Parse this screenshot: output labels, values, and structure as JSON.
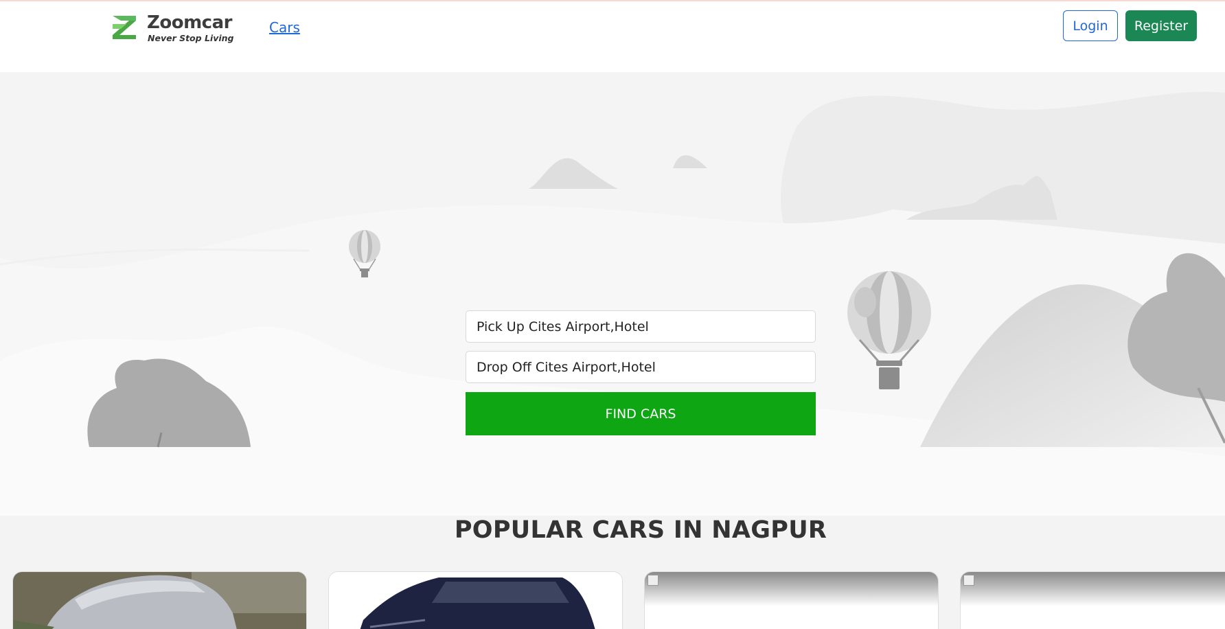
{
  "header": {
    "brand_name": "Zoomcar",
    "brand_tagline": "Never Stop Living",
    "nav_link": "Cars",
    "login_label": "Login",
    "register_label": "Register"
  },
  "search": {
    "pickup_value": "Pick Up Cites Airport,Hotel",
    "dropoff_value": "Drop Off Cites Airport,Hotel",
    "submit_label": "FIND CARS"
  },
  "popular": {
    "title": "POPULAR CARS IN NAGPUR",
    "cards": [
      {
        "image": "silver-car-photo"
      },
      {
        "image": "navy-suv-photo"
      },
      {
        "image": "broken-image"
      },
      {
        "image": "broken-image"
      }
    ]
  },
  "colors": {
    "brand_green": "#0fa614",
    "register_green": "#1a8754",
    "link_blue": "#1f66d6"
  },
  "icons": [
    "zoomcar-logo-icon",
    "hot-air-balloon-icon",
    "broken-image-icon"
  ]
}
